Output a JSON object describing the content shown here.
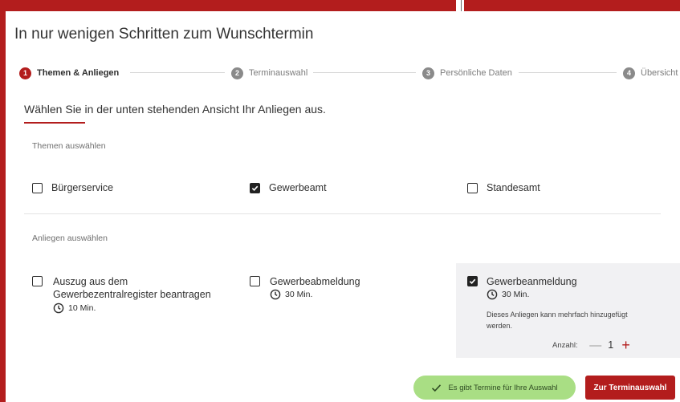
{
  "page": {
    "title": "In nur wenigen Schritten zum Wunschtermin",
    "instruction": "Wählen Sie in der unten stehenden Ansicht Ihr Anliegen aus."
  },
  "stepper": {
    "steps": [
      {
        "number": "1",
        "label": "Themen & Anliegen",
        "active": true
      },
      {
        "number": "2",
        "label": "Terminauswahl",
        "active": false
      },
      {
        "number": "3",
        "label": "Persönliche Daten",
        "active": false
      },
      {
        "number": "4",
        "label": "Übersicht",
        "active": false
      }
    ]
  },
  "themen": {
    "label": "Themen auswählen",
    "items": [
      {
        "label": "Bürgerservice",
        "checked": false
      },
      {
        "label": "Gewerbeamt",
        "checked": true
      },
      {
        "label": "Standesamt",
        "checked": false
      }
    ]
  },
  "anliegen": {
    "label": "Anliegen auswählen",
    "items": [
      {
        "title_line1": "Auszug aus dem",
        "title_line2": "Gewerbezentralregister beantragen",
        "duration": "10 Min.",
        "checked": false
      },
      {
        "title_line1": "Gewerbeabmeldung",
        "duration": "30 Min.",
        "checked": false
      },
      {
        "title_line1": "Gewerbeanmeldung",
        "duration": "30 Min.",
        "checked": true,
        "note": "Dieses Anliegen kann mehrfach hinzugefügt werden.",
        "quantity_label": "Anzahl:",
        "quantity_value": "1",
        "minus": "—",
        "plus": "+"
      }
    ]
  },
  "footer": {
    "status_text": "Es gibt Termine für Ihre Auswahl",
    "next_button_label": "Zur Terminauswahl"
  },
  "colors": {
    "brand_red": "#b31d1d",
    "success_green": "#a9de84",
    "selected_card_bg": "#f1f1f3"
  },
  "icons": {
    "step_badge": "numbered-circle",
    "checkbox_checked": "checkmark",
    "duration": "clock-icon",
    "status": "check-icon"
  }
}
